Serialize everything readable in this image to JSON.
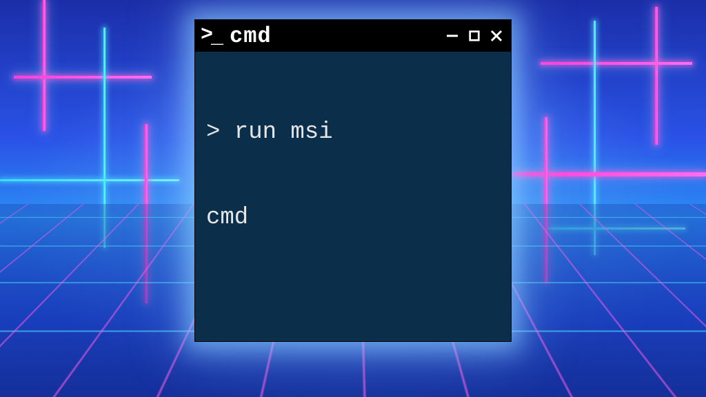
{
  "window": {
    "title": "cmd",
    "icon_name": "prompt-icon",
    "controls": {
      "minimize_icon": "minimize-icon",
      "maximize_icon": "maximize-icon",
      "close_icon": "close-icon"
    }
  },
  "terminal": {
    "prompt_symbol": ">",
    "lines": [
      {
        "prompt": "> ",
        "text": "run msi cmd"
      }
    ],
    "line1": "> run msi",
    "line2": "cmd"
  },
  "colors": {
    "titlebar_bg": "#000000",
    "terminal_bg": "#0b2f4a",
    "terminal_fg": "#e6e6e6",
    "neon_pink": "#ff3fd8",
    "neon_cyan": "#34e0ff"
  }
}
